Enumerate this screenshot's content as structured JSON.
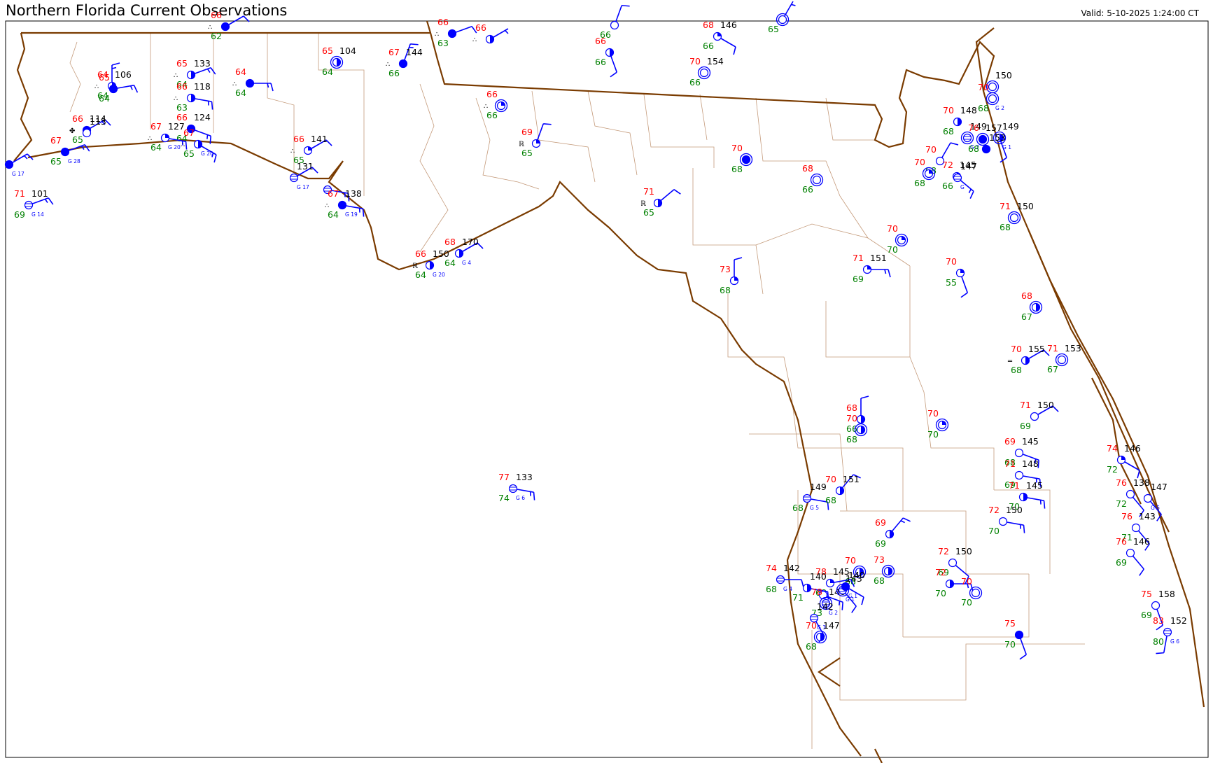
{
  "header": {
    "title": "Northern Florida Current Observations",
    "valid": "Valid: 5-10-2025 1:24:00 CT"
  },
  "colors": {
    "temperature": "#ff0000",
    "dewpoint": "#008000",
    "pressure": "#000000",
    "station": "#0000ff",
    "coastline": "#7a3b00",
    "county": "#c49a7a"
  },
  "stations": [
    {
      "t": "66",
      "d": "62",
      "p": "",
      "sky": "full",
      "dir": 60,
      "spd": 10,
      "wx": "∴"
    },
    {
      "t": "66",
      "d": "63",
      "p": "",
      "sky": "full",
      "dir": 70,
      "spd": 10,
      "wx": "∴"
    },
    {
      "t": "66",
      "d": "",
      "p": "",
      "sky": "half",
      "dir": 60,
      "spd": 5,
      "wx": "∴"
    },
    {
      "t": "",
      "d": "66",
      "p": "",
      "sky": "",
      "dir": 20,
      "spd": 10,
      "wx": ""
    },
    {
      "t": "66",
      "d": "66",
      "p": "",
      "sky": "half",
      "dir": 160,
      "spd": 10,
      "wx": ""
    },
    {
      "t": "68",
      "d": "66",
      "p": "146",
      "sky": "quarter",
      "dir": 120,
      "spd": 10,
      "wx": ""
    },
    {
      "t": "",
      "d": "65",
      "p": "",
      "sky": "ring",
      "dir": 30,
      "spd": 5,
      "wx": ""
    },
    {
      "t": "70",
      "d": "66",
      "p": "154",
      "sky": "ring",
      "dir": 0,
      "spd": 0,
      "wx": ""
    },
    {
      "t": "64",
      "d": "64",
      "p": "106",
      "sky": "half",
      "dir": 0,
      "spd": 15,
      "wx": "∴"
    },
    {
      "t": "65",
      "d": "64",
      "p": "",
      "sky": "full",
      "dir": 80,
      "spd": 15,
      "wx": ""
    },
    {
      "t": "65",
      "d": "64",
      "p": "133",
      "sky": "half",
      "dir": 70,
      "spd": 15,
      "wx": "∴"
    },
    {
      "t": "66",
      "d": "63",
      "p": "118",
      "sky": "half",
      "dir": 100,
      "spd": 15,
      "wx": "∴"
    },
    {
      "t": "64",
      "d": "64",
      "p": "",
      "sky": "full",
      "dir": 90,
      "spd": 15,
      "wx": "∴"
    },
    {
      "t": "65",
      "d": "64",
      "p": "104",
      "sky": "ring-half",
      "dir": 0,
      "spd": 0,
      "wx": ""
    },
    {
      "t": "67",
      "d": "66",
      "p": "144",
      "sky": "full",
      "dir": 20,
      "spd": 15,
      "wx": "∴"
    },
    {
      "t": "66",
      "d": "66",
      "p": "",
      "sky": "ring-quarter",
      "dir": 0,
      "spd": 0,
      "wx": "∴"
    },
    {
      "t": "66",
      "d": "65",
      "p": "114",
      "sky": "full",
      "dir": 60,
      "spd": 15,
      "wx": "✤"
    },
    {
      "t": "",
      "d": "",
      "p": "113",
      "sky": "",
      "dir": 0,
      "spd": 0,
      "wx": ""
    },
    {
      "t": "66",
      "d": "64",
      "p": "124",
      "sky": "full",
      "dir": 110,
      "spd": 15,
      "wx": ""
    },
    {
      "t": "67",
      "d": "64",
      "p": "127",
      "sky": "quarter",
      "dir": 100,
      "spd": 15,
      "wx": "∴",
      "gust": "G 20"
    },
    {
      "t": "67",
      "d": "65",
      "p": "",
      "sky": "half",
      "dir": 120,
      "spd": 15,
      "wx": "∴",
      "gust": "G 20"
    },
    {
      "t": "67",
      "d": "65",
      "p": "",
      "sky": "full",
      "dir": 70,
      "spd": 15,
      "wx": "",
      "gust": "G 28"
    },
    {
      "t": "",
      "d": "",
      "p": "",
      "sky": "full",
      "dir": 60,
      "spd": 15,
      "wx": "",
      "gust": "G 17"
    },
    {
      "t": "71",
      "d": "69",
      "p": "101",
      "sky": "obscured",
      "dir": 70,
      "spd": 15,
      "wx": "",
      "gust": "G 14"
    },
    {
      "t": "66",
      "d": "65",
      "p": "141",
      "sky": "quarter",
      "dir": 60,
      "spd": 10,
      "wx": "∴"
    },
    {
      "t": "",
      "d": "",
      "p": "131",
      "sky": "obscured",
      "dir": 60,
      "spd": 10,
      "wx": "",
      "gust": "G 17"
    },
    {
      "t": "",
      "d": "",
      "p": "",
      "sky": "obscured",
      "dir": 100,
      "spd": 15,
      "wx": ""
    },
    {
      "t": "67",
      "d": "64",
      "p": "138",
      "sky": "full",
      "dir": 100,
      "spd": 15,
      "wx": "∴",
      "gust": "G 19"
    },
    {
      "t": "69",
      "d": "65",
      "p": "",
      "sky": "quarter",
      "dir": 20,
      "spd": 10,
      "wx": "ℝ"
    },
    {
      "t": "66",
      "d": "64",
      "p": "150",
      "sky": "half",
      "dir": 0,
      "spd": 0,
      "wx": "ℝ",
      "gust": "G 20"
    },
    {
      "t": "68",
      "d": "64",
      "p": "170",
      "sky": "half",
      "dir": 60,
      "spd": 10,
      "wx": "",
      "gust": "G 4"
    },
    {
      "t": "70",
      "d": "68",
      "p": "",
      "sky": "ring-full",
      "dir": 0,
      "spd": 0,
      "wx": ""
    },
    {
      "t": "68",
      "d": "66",
      "p": "",
      "sky": "ring",
      "dir": 0,
      "spd": 0,
      "wx": ""
    },
    {
      "t": "71",
      "d": "65",
      "p": "",
      "sky": "half",
      "dir": 50,
      "spd": 10,
      "wx": "ℝ"
    },
    {
      "t": "73",
      "d": "68",
      "p": "",
      "sky": "quarter",
      "dir": 0,
      "spd": 10,
      "wx": ""
    },
    {
      "t": "71",
      "d": "69",
      "p": "151",
      "sky": "quarter",
      "dir": 90,
      "spd": 15,
      "wx": ""
    },
    {
      "t": "70",
      "d": "70",
      "p": "",
      "sky": "ring-quarter",
      "dir": 0,
      "spd": 0,
      "wx": ""
    },
    {
      "t": "70",
      "d": "55",
      "p": "",
      "sky": "quarter",
      "dir": 160,
      "spd": 10,
      "wx": ""
    },
    {
      "t": "",
      "d": "",
      "p": "150",
      "sky": "ring",
      "dir": 0,
      "spd": 0,
      "wx": ""
    },
    {
      "t": "70",
      "d": "68",
      "p": "",
      "sky": "ring",
      "dir": 0,
      "spd": 0,
      "wx": "",
      "gust": "G 2"
    },
    {
      "t": "70",
      "d": "68",
      "p": "148",
      "sky": "half",
      "dir": 0,
      "spd": 0,
      "wx": ""
    },
    {
      "t": "",
      "d": "",
      "p": "149",
      "sky": "ring-obscured",
      "dir": 0,
      "spd": 0,
      "wx": "",
      "gust": "G 2"
    },
    {
      "t": "76",
      "d": "68",
      "p": "157",
      "sky": "ring-full",
      "dir": 0,
      "spd": 0,
      "wx": ""
    },
    {
      "t": "",
      "d": "",
      "p": "149",
      "sky": "ring-half",
      "dir": 160,
      "spd": 10,
      "wx": "",
      "gust": "G 1"
    },
    {
      "t": "",
      "d": "",
      "p": "153",
      "sky": "full",
      "dir": 0,
      "spd": 0,
      "wx": ""
    },
    {
      "t": "70",
      "d": "68",
      "p": "",
      "sky": "",
      "dir": 30,
      "spd": 10,
      "wx": ""
    },
    {
      "t": "70",
      "d": "68",
      "p": "",
      "sky": "ring-quarter",
      "dir": 0,
      "spd": 0,
      "wx": ""
    },
    {
      "t": "72",
      "d": "66",
      "p": "145",
      "sky": "half",
      "dir": 0,
      "spd": 0,
      "wx": ""
    },
    {
      "t": "",
      "d": "",
      "p": "147",
      "sky": "obscured",
      "dir": 130,
      "spd": 15,
      "wx": "",
      "gust": "G"
    },
    {
      "t": "71",
      "d": "68",
      "p": "150",
      "sky": "ring",
      "dir": 0,
      "spd": 0,
      "wx": ""
    },
    {
      "t": "68",
      "d": "67",
      "p": "",
      "sky": "ring-half",
      "dir": 0,
      "spd": 0,
      "wx": ""
    },
    {
      "t": "71",
      "d": "67",
      "p": "153",
      "sky": "ring",
      "dir": 0,
      "spd": 0,
      "wx": ""
    },
    {
      "t": "70",
      "d": "68",
      "p": "155",
      "sky": "half",
      "dir": 60,
      "spd": 10,
      "wx": "═"
    },
    {
      "t": "68",
      "d": "66",
      "p": "",
      "sky": "half",
      "dir": 0,
      "spd": 10,
      "wx": ""
    },
    {
      "t": "70",
      "d": "68",
      "p": "",
      "sky": "ring-half",
      "dir": 0,
      "spd": 0,
      "wx": ""
    },
    {
      "t": "70",
      "d": "70",
      "p": "",
      "sky": "ring-quarter",
      "dir": 0,
      "spd": 0,
      "wx": ""
    },
    {
      "t": "71",
      "d": "69",
      "p": "150",
      "sky": "",
      "dir": 60,
      "spd": 10,
      "wx": ""
    },
    {
      "t": "69",
      "d": "68",
      "p": "145",
      "sky": "",
      "dir": 110,
      "spd": 15,
      "wx": ""
    },
    {
      "t": "74",
      "d": "72",
      "p": "146",
      "sky": "quarter",
      "dir": 120,
      "spd": 10,
      "wx": ""
    },
    {
      "t": "71",
      "d": "69",
      "p": "148",
      "sky": "",
      "dir": 100,
      "spd": 15,
      "wx": ""
    },
    {
      "t": "71",
      "d": "70",
      "p": "145",
      "sky": "half",
      "dir": 100,
      "spd": 15,
      "wx": ""
    },
    {
      "t": "76",
      "d": "72",
      "p": "138",
      "sky": "",
      "dir": 140,
      "spd": 10,
      "wx": ""
    },
    {
      "t": "",
      "d": "",
      "p": "147",
      "sky": "",
      "dir": 140,
      "spd": 10,
      "wx": "",
      "gust": "G 5"
    },
    {
      "t": "72",
      "d": "70",
      "p": "150",
      "sky": "",
      "dir": 100,
      "spd": 15,
      "wx": ""
    },
    {
      "t": "76",
      "d": "71",
      "p": "143",
      "sky": "",
      "dir": 140,
      "spd": 10,
      "wx": ""
    },
    {
      "t": "76",
      "d": "69",
      "p": "146",
      "sky": "",
      "dir": 140,
      "spd": 10,
      "wx": ""
    },
    {
      "t": "77",
      "d": "74",
      "p": "133",
      "sky": "obscured",
      "dir": 100,
      "spd": 15,
      "wx": "",
      "gust": "G 6"
    },
    {
      "t": "",
      "d": "68",
      "p": "149",
      "sky": "obscured",
      "dir": 100,
      "spd": 10,
      "wx": "",
      "gust": "G 5"
    },
    {
      "t": "70",
      "d": "68",
      "p": "151",
      "sky": "half",
      "dir": 40,
      "spd": 10,
      "wx": ""
    },
    {
      "t": "69",
      "d": "69",
      "p": "",
      "sky": "half",
      "dir": 40,
      "spd": 15,
      "wx": ""
    },
    {
      "t": "70",
      "d": "68",
      "p": "",
      "sky": "ring-half",
      "dir": 0,
      "spd": 0,
      "wx": ""
    },
    {
      "t": "73",
      "d": "68",
      "p": "",
      "sky": "ring-half",
      "dir": 0,
      "spd": 0,
      "wx": ""
    },
    {
      "t": "72",
      "d": "69",
      "p": "150",
      "sky": "",
      "dir": 130,
      "spd": 10,
      "wx": ""
    },
    {
      "t": "72",
      "d": "70",
      "p": "",
      "sky": "half",
      "dir": 90,
      "spd": 15,
      "wx": ""
    },
    {
      "t": "70",
      "d": "70",
      "p": "",
      "sky": "ring",
      "dir": 0,
      "spd": 0,
      "wx": ""
    },
    {
      "t": "74",
      "d": "68",
      "p": "142",
      "sky": "obscured",
      "dir": 90,
      "spd": 10,
      "wx": "",
      "gust": "G 4"
    },
    {
      "t": "78",
      "d": "68",
      "p": "145",
      "sky": "quarter",
      "dir": 80,
      "spd": 10,
      "wx": ""
    },
    {
      "t": "",
      "d": "71",
      "p": "140",
      "sky": "half",
      "dir": 100,
      "spd": 10,
      "wx": ""
    },
    {
      "t": "",
      "d": "",
      "p": "",
      "sky": "",
      "dir": 110,
      "spd": 15,
      "wx": ""
    },
    {
      "t": "78",
      "d": "73",
      "p": "146",
      "sky": "ring-obscured",
      "dir": 0,
      "spd": 0,
      "wx": "",
      "gust": "G 2"
    },
    {
      "t": "",
      "d": "",
      "p": "143",
      "sky": "ring-obscured",
      "dir": 140,
      "spd": 10,
      "wx": "",
      "gust": "G 1"
    },
    {
      "t": "",
      "d": "",
      "p": "140",
      "sky": "full",
      "dir": 120,
      "spd": 10,
      "wx": "",
      "gust": "G 1"
    },
    {
      "t": "",
      "d": "",
      "p": "142",
      "sky": "obscured",
      "dir": 150,
      "spd": 10,
      "wx": "",
      "gust": "G 3"
    },
    {
      "t": "70",
      "d": "68",
      "p": "147",
      "sky": "ring-half",
      "dir": 0,
      "spd": 0,
      "wx": ""
    },
    {
      "t": "75",
      "d": "70",
      "p": "",
      "sky": "full",
      "dir": 160,
      "spd": 10,
      "wx": ""
    },
    {
      "t": "75",
      "d": "69",
      "p": "158",
      "sky": "",
      "dir": 160,
      "spd": 10,
      "wx": ""
    },
    {
      "t": "83",
      "d": "80",
      "p": "152",
      "sky": "obscured",
      "dir": 190,
      "spd": 10,
      "wx": "",
      "gust": "G 6"
    }
  ]
}
